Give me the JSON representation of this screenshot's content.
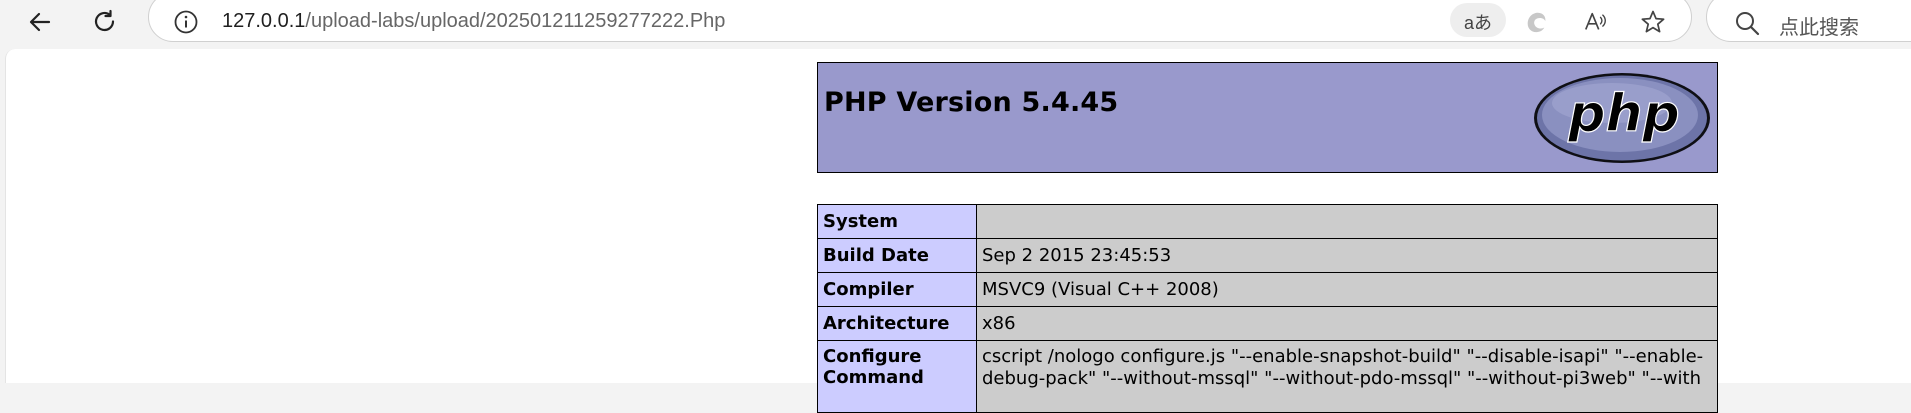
{
  "browser": {
    "url_host": "127.0.0.1",
    "url_path": "/upload-labs/upload/202501211259277222.Php",
    "read_aloud_icon_label": "A̶",
    "translate_label": "aあ",
    "search_placeholder": "点此搜索"
  },
  "php_header": {
    "title": "PHP Version 5.4.45",
    "logo_text": "php"
  },
  "info_table": {
    "rows": [
      {
        "key": "System",
        "value": ""
      },
      {
        "key": "Build Date",
        "value": "Sep 2 2015 23:45:53"
      },
      {
        "key": "Compiler",
        "value": "MSVC9 (Visual C++ 2008)"
      },
      {
        "key": "Architecture",
        "value": "x86"
      },
      {
        "key": "Configure Command",
        "value": "cscript /nologo configure.js \"--enable-snapshot-build\" \"--disable-isapi\" \"--enable-debug-pack\" \"--without-mssql\" \"--without-pdo-mssql\" \"--without-pi3web\" \"--with"
      }
    ]
  },
  "colors": {
    "header_bg": "#9999cc",
    "key_bg": "#ccccff",
    "value_bg": "#cccccc"
  }
}
